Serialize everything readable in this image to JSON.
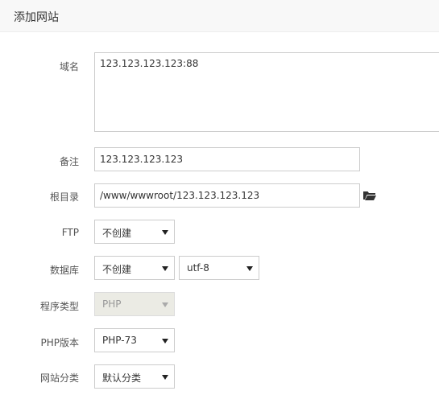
{
  "dialog": {
    "title": "添加网站"
  },
  "form": {
    "domain": {
      "label": "域名",
      "value": "123.123.123.123:88"
    },
    "remark": {
      "label": "备注",
      "value": "123.123.123.123"
    },
    "root_dir": {
      "label": "根目录",
      "value": "/www/wwwroot/123.123.123.123",
      "icon": "folder-open-icon"
    },
    "ftp": {
      "label": "FTP",
      "value": "不创建"
    },
    "database": {
      "label": "数据库",
      "value": "不创建",
      "charset": "utf-8"
    },
    "program_type": {
      "label": "程序类型",
      "value": "PHP"
    },
    "php_version": {
      "label": "PHP版本",
      "value": "PHP-73"
    },
    "site_category": {
      "label": "网站分类",
      "value": "默认分类"
    }
  }
}
